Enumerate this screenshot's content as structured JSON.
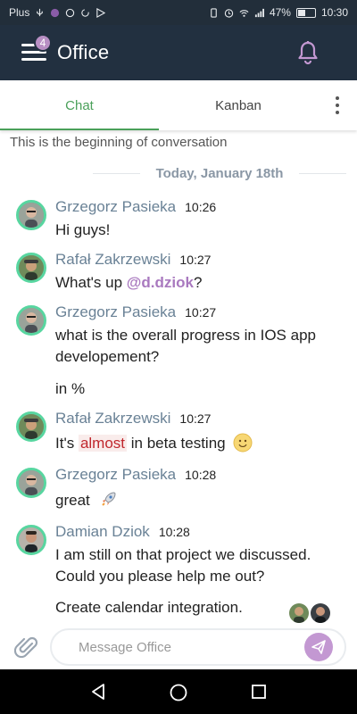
{
  "statusbar": {
    "carrier": "Plus",
    "battery": "47%",
    "time": "10:30"
  },
  "header": {
    "badge_count": "4",
    "title": "Office"
  },
  "tabs": [
    {
      "label": "Chat",
      "active": true
    },
    {
      "label": "Kanban",
      "active": false
    }
  ],
  "conversation": {
    "start_text": "This is the beginning of conversation",
    "day_label": "Today, January 18th"
  },
  "messages": [
    {
      "sender": "Grzegorz Pasieka",
      "time": "10:26",
      "lines": [
        "Hi guys!"
      ]
    },
    {
      "sender": "Rafał Zakrzewski",
      "time": "10:27",
      "lines": [
        "What's up",
        "@d.dziok",
        "?"
      ]
    },
    {
      "sender": "Grzegorz Pasieka",
      "time": "10:27",
      "lines": [
        "what is the overall progress in IOS app",
        "developement?",
        "in %"
      ]
    },
    {
      "sender": "Rafał Zakrzewski",
      "time": "10:27",
      "lines": [
        "It's",
        "almost",
        "in beta testing"
      ]
    },
    {
      "sender": "Grzegorz Pasieka",
      "time": "10:28",
      "lines": [
        "great"
      ]
    },
    {
      "sender": "Damian Dziok",
      "time": "10:28",
      "lines": [
        "I am still on that project we discussed.",
        "Could you please help me out?",
        "Create calendar integration."
      ]
    }
  ],
  "composer": {
    "placeholder": "Message Office"
  },
  "colors": {
    "accent_green": "#4aa05a",
    "header_bg": "#223040",
    "brand_purple": "#b88fc4",
    "mention": "#a979bf",
    "avatar_ring": "#58d6a0"
  }
}
